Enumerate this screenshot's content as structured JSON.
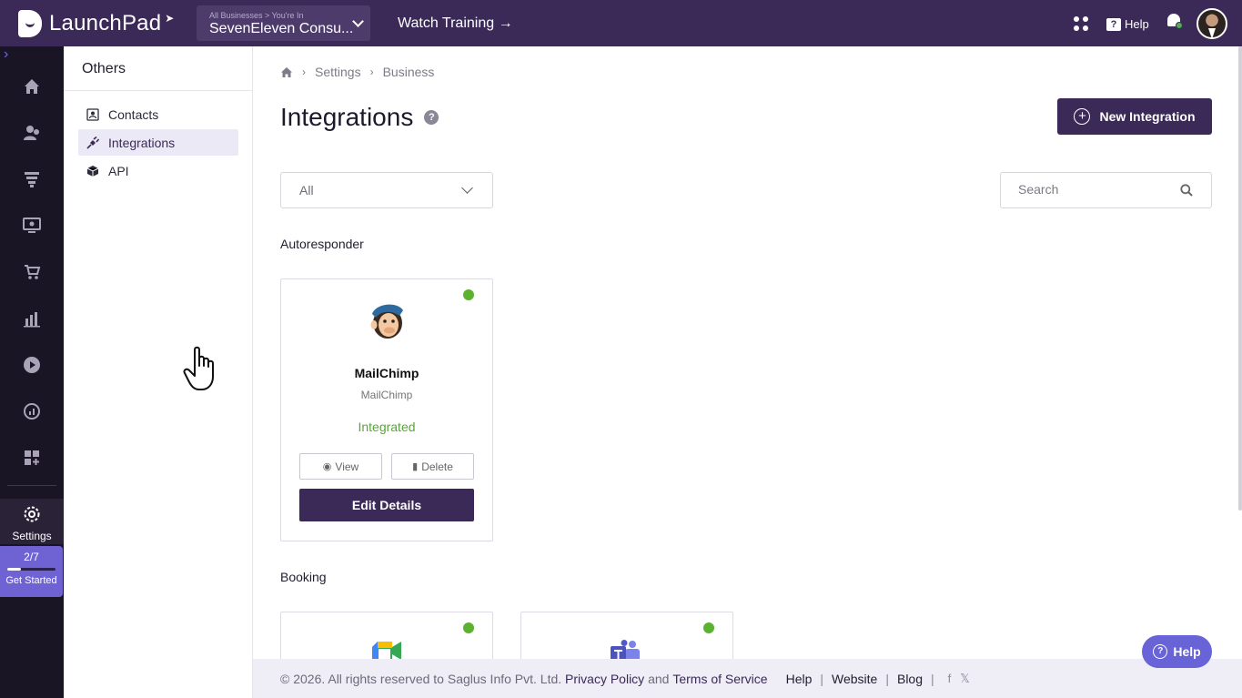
{
  "header": {
    "brand": "LaunchPad",
    "business_select": {
      "small_label": "All Businesses > You're In",
      "selected": "SevenEleven Consu..."
    },
    "watch_training": "Watch Training →",
    "help_label": "Help",
    "icons": [
      "apps-grid-icon",
      "help-icon",
      "bell-icon",
      "avatar"
    ],
    "colors": {
      "primary": "#3b2a57",
      "status_green": "#5bb130"
    }
  },
  "leftnav": {
    "items": [
      "home-icon",
      "contacts-icon",
      "funnel-icon",
      "webinar-icon",
      "store-icon",
      "analytics-icon",
      "video-icon",
      "dashboard-icon",
      "apps-add-icon"
    ],
    "settings_label": "Settings",
    "get_started": {
      "count": "2/7",
      "label": "Get Started",
      "progress": 0.2857
    }
  },
  "subnav": {
    "title": "Others",
    "items": [
      {
        "label": "Contacts",
        "icon": "contacts-icon"
      },
      {
        "label": "Integrations",
        "icon": "plug-icon"
      },
      {
        "label": "API",
        "icon": "cube-icon"
      }
    ]
  },
  "main": {
    "breadcrumb": [
      "Settings",
      "Business"
    ],
    "title": "Integrations",
    "new_button": "New Integration",
    "filter": {
      "selected": "All"
    },
    "search": {
      "placeholder": "Search"
    },
    "sections": [
      {
        "title": "Autoresponder",
        "cards": [
          {
            "name": "MailChimp",
            "sub": "MailChimp",
            "status": "Integrated",
            "view": "View",
            "delete": "Delete",
            "edit": "Edit Details"
          }
        ]
      },
      {
        "title": "Booking"
      }
    ]
  },
  "footer": {
    "copyright": "©  2026. All rights reserved to Saglus Info Pvt. Ltd.",
    "privacy": "Privacy Policy",
    "and": "and",
    "terms": "Terms of Service",
    "help": "Help",
    "website": "Website",
    "blog": "Blog"
  },
  "help_float": "Help"
}
